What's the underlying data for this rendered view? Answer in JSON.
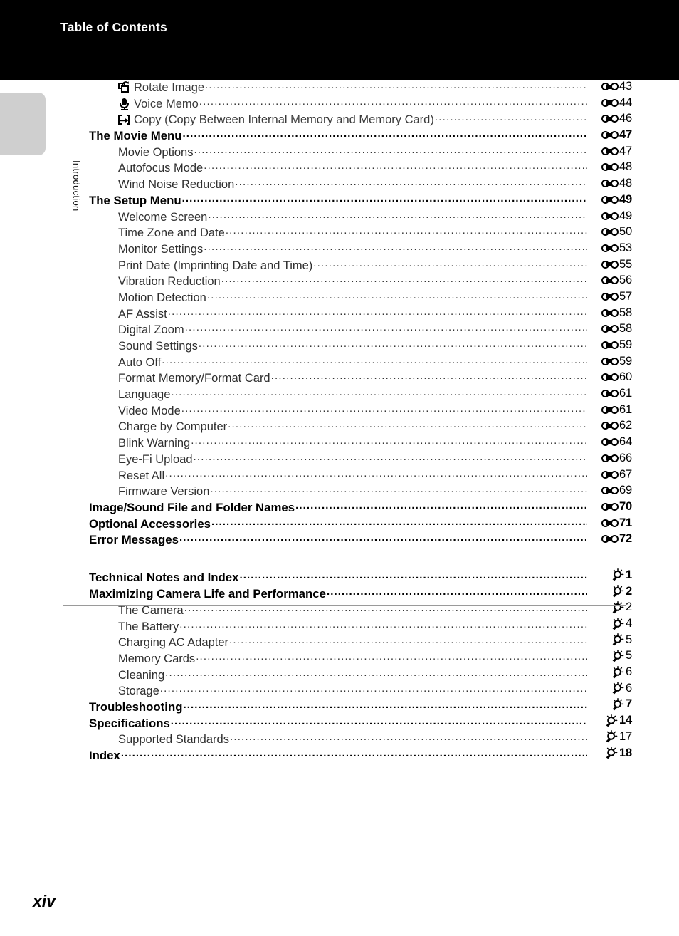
{
  "header": {
    "title": "Table of Contents"
  },
  "sidebar": {
    "tab_label": "Introduction"
  },
  "footer": {
    "page_number": "xiv"
  },
  "marks": {
    "reference": "reference-section-icon",
    "technical": "light-bulb-icon"
  },
  "toc": {
    "section_reference": [
      {
        "level": 0,
        "icon": "rotate-image-icon",
        "label": "Rotate Image",
        "mark": "reference",
        "page": "43"
      },
      {
        "level": 0,
        "icon": "microphone-icon",
        "label": "Voice Memo",
        "mark": "reference",
        "page": "44"
      },
      {
        "level": 0,
        "icon": "copy-icon",
        "label": "Copy (Copy Between Internal Memory and Memory Card)",
        "mark": "reference",
        "page": "46"
      },
      {
        "level": 1,
        "icon": "",
        "label": "The Movie Menu",
        "mark": "reference",
        "page": "47"
      },
      {
        "level": 2,
        "icon": "",
        "label": "Movie Options",
        "mark": "reference",
        "page": "47"
      },
      {
        "level": 2,
        "icon": "",
        "label": "Autofocus Mode",
        "mark": "reference",
        "page": "48"
      },
      {
        "level": 2,
        "icon": "",
        "label": "Wind Noise Reduction",
        "mark": "reference",
        "page": "48"
      },
      {
        "level": 1,
        "icon": "",
        "label": "The Setup Menu",
        "mark": "reference",
        "page": "49"
      },
      {
        "level": 2,
        "icon": "",
        "label": "Welcome Screen",
        "mark": "reference",
        "page": "49"
      },
      {
        "level": 2,
        "icon": "",
        "label": "Time Zone and Date",
        "mark": "reference",
        "page": "50"
      },
      {
        "level": 2,
        "icon": "",
        "label": "Monitor Settings",
        "mark": "reference",
        "page": "53"
      },
      {
        "level": 2,
        "icon": "",
        "label": "Print Date (Imprinting Date and Time)",
        "mark": "reference",
        "page": "55"
      },
      {
        "level": 2,
        "icon": "",
        "label": "Vibration Reduction",
        "mark": "reference",
        "page": "56"
      },
      {
        "level": 2,
        "icon": "",
        "label": "Motion Detection",
        "mark": "reference",
        "page": "57"
      },
      {
        "level": 2,
        "icon": "",
        "label": "AF Assist",
        "mark": "reference",
        "page": "58"
      },
      {
        "level": 2,
        "icon": "",
        "label": "Digital Zoom",
        "mark": "reference",
        "page": "58"
      },
      {
        "level": 2,
        "icon": "",
        "label": "Sound Settings",
        "mark": "reference",
        "page": "59"
      },
      {
        "level": 2,
        "icon": "",
        "label": "Auto Off",
        "mark": "reference",
        "page": "59"
      },
      {
        "level": 2,
        "icon": "",
        "label": "Format Memory/Format Card",
        "mark": "reference",
        "page": "60"
      },
      {
        "level": 2,
        "icon": "",
        "label": "Language",
        "mark": "reference",
        "page": "61"
      },
      {
        "level": 2,
        "icon": "",
        "label": "Video Mode",
        "mark": "reference",
        "page": "61"
      },
      {
        "level": 2,
        "icon": "",
        "label": "Charge by Computer",
        "mark": "reference",
        "page": "62"
      },
      {
        "level": 2,
        "icon": "",
        "label": "Blink Warning",
        "mark": "reference",
        "page": "64"
      },
      {
        "level": 2,
        "icon": "",
        "label": "Eye-Fi Upload",
        "mark": "reference",
        "page": "66"
      },
      {
        "level": 2,
        "icon": "",
        "label": "Reset All",
        "mark": "reference",
        "page": "67"
      },
      {
        "level": 2,
        "icon": "",
        "label": "Firmware Version",
        "mark": "reference",
        "page": "69"
      },
      {
        "level": 1,
        "icon": "",
        "label": "Image/Sound File and Folder Names",
        "mark": "reference",
        "page": "70"
      },
      {
        "level": 1,
        "icon": "",
        "label": "Optional Accessories",
        "mark": "reference",
        "page": "71"
      },
      {
        "level": 1,
        "icon": "",
        "label": "Error Messages",
        "mark": "reference",
        "page": "72"
      }
    ],
    "section_technical": [
      {
        "level": 1,
        "icon": "",
        "label": "Technical Notes and Index",
        "mark": "technical",
        "page": "1",
        "top": true
      },
      {
        "level": 1,
        "icon": "",
        "label": "Maximizing Camera Life and Performance",
        "mark": "technical",
        "page": "2"
      },
      {
        "level": 2,
        "icon": "",
        "label": "The Camera",
        "mark": "technical",
        "page": "2"
      },
      {
        "level": 2,
        "icon": "",
        "label": "The Battery",
        "mark": "technical",
        "page": "4"
      },
      {
        "level": 2,
        "icon": "",
        "label": "Charging AC Adapter",
        "mark": "technical",
        "page": "5"
      },
      {
        "level": 2,
        "icon": "",
        "label": "Memory Cards",
        "mark": "technical",
        "page": "5"
      },
      {
        "level": 2,
        "icon": "",
        "label": "Cleaning",
        "mark": "technical",
        "page": "6"
      },
      {
        "level": 2,
        "icon": "",
        "label": "Storage",
        "mark": "technical",
        "page": "6"
      },
      {
        "level": 1,
        "icon": "",
        "label": "Troubleshooting",
        "mark": "technical",
        "page": "7"
      },
      {
        "level": 1,
        "icon": "",
        "label": "Specifications",
        "mark": "technical",
        "page": "14"
      },
      {
        "level": 2,
        "icon": "",
        "label": "Supported Standards",
        "mark": "technical",
        "page": "17"
      },
      {
        "level": 1,
        "icon": "",
        "label": "Index",
        "mark": "technical",
        "page": "18"
      }
    ]
  }
}
